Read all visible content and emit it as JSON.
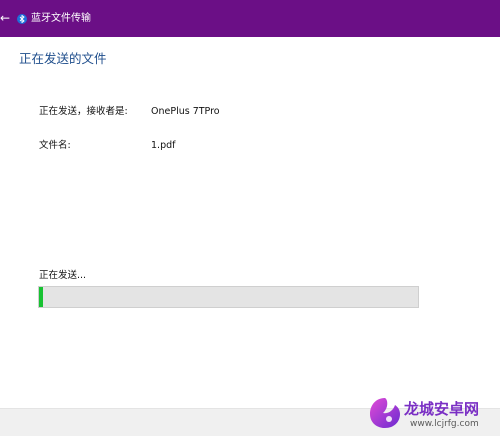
{
  "window": {
    "title": "蓝牙文件传输",
    "accent_color": "#6b0f86",
    "title_icon": "bluetooth-icon",
    "back_icon": "back-arrow-icon"
  },
  "main": {
    "heading": "正在发送的文件",
    "recipient_label": "正在发送，接收者是:",
    "recipient_value": "OnePlus 7TPro",
    "filename_label": "文件名:",
    "filename_value": "1.pdf",
    "status_label": "正在发送...",
    "progress": 0.01,
    "progress_color": "#18c232"
  },
  "watermark": {
    "title": "龙城安卓网",
    "url": "www.lcjrfg.com",
    "color": "#7a2fc4"
  }
}
